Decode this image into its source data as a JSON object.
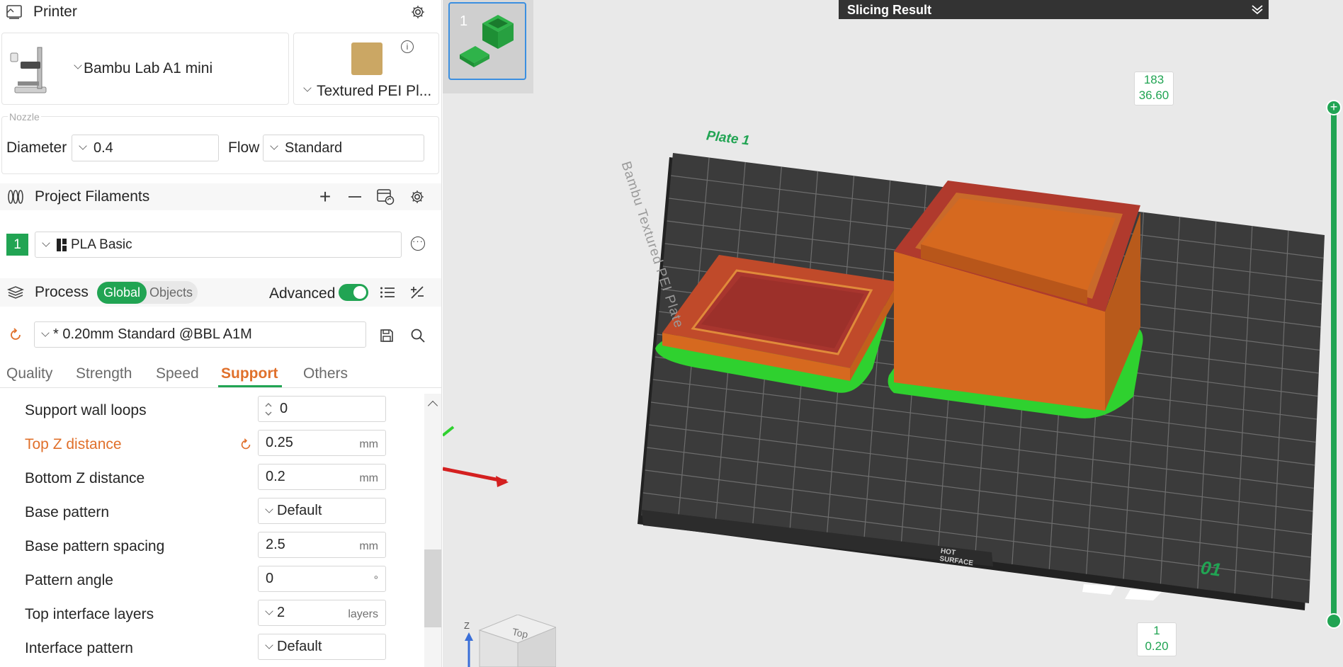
{
  "printer": {
    "section_title": "Printer",
    "machine": "Bambu Lab A1 mini",
    "plate_type": "Textured PEI Pl...",
    "nozzle_group": "Nozzle",
    "diameter_label": "Diameter",
    "diameter_value": "0.4",
    "flow_label": "Flow",
    "flow_value": "Standard"
  },
  "filaments": {
    "section_title": "Project Filaments",
    "items": [
      {
        "index": "1",
        "name": "PLA Basic",
        "color": "#21a453"
      }
    ]
  },
  "process": {
    "section_title": "Process",
    "scope_options": [
      "Global",
      "Objects"
    ],
    "scope_selected": "Global",
    "advanced_label": "Advanced",
    "advanced_on": true,
    "preset": "* 0.20mm Standard @BBL A1M",
    "tabs": [
      "Quality",
      "Strength",
      "Speed",
      "Support",
      "Others"
    ],
    "active_tab": "Support",
    "params": [
      {
        "label": "Support wall loops",
        "value": "0",
        "unit": "",
        "control": "spin",
        "changed": false
      },
      {
        "label": "Top Z distance",
        "value": "0.25",
        "unit": "mm",
        "control": "text",
        "changed": true
      },
      {
        "label": "Bottom Z distance",
        "value": "0.2",
        "unit": "mm",
        "control": "text",
        "changed": false
      },
      {
        "label": "Base pattern",
        "value": "Default",
        "unit": "",
        "control": "combo",
        "changed": false
      },
      {
        "label": "Base pattern spacing",
        "value": "2.5",
        "unit": "mm",
        "control": "text",
        "changed": false
      },
      {
        "label": "Pattern angle",
        "value": "0",
        "unit": "°",
        "control": "text",
        "changed": false
      },
      {
        "label": "Top interface layers",
        "value": "2",
        "unit": "layers",
        "control": "combo",
        "changed": false
      },
      {
        "label": "Interface pattern",
        "value": "Default",
        "unit": "",
        "control": "combo",
        "changed": false
      }
    ]
  },
  "viewport": {
    "plate_thumb_index": "1",
    "slicing_result_title": "Slicing Result",
    "plate_label": "Plate 1",
    "bed_text": "Bambu Textured PEI Plate",
    "bed_number": "01",
    "hot_surface": "HOT SURFACE",
    "cube_face": "Top",
    "axis_z": "Z",
    "layer_slider": {
      "top_layer": "183",
      "top_height": "36.60",
      "bottom_layer": "1",
      "bottom_height": "0.20"
    }
  },
  "colors": {
    "accent_green": "#21a453",
    "accent_orange": "#e0702b",
    "model_orange": "#d6691f",
    "model_red": "#a8352e",
    "support_green": "#2fd12f",
    "bed_dark": "#3a3a3a"
  }
}
